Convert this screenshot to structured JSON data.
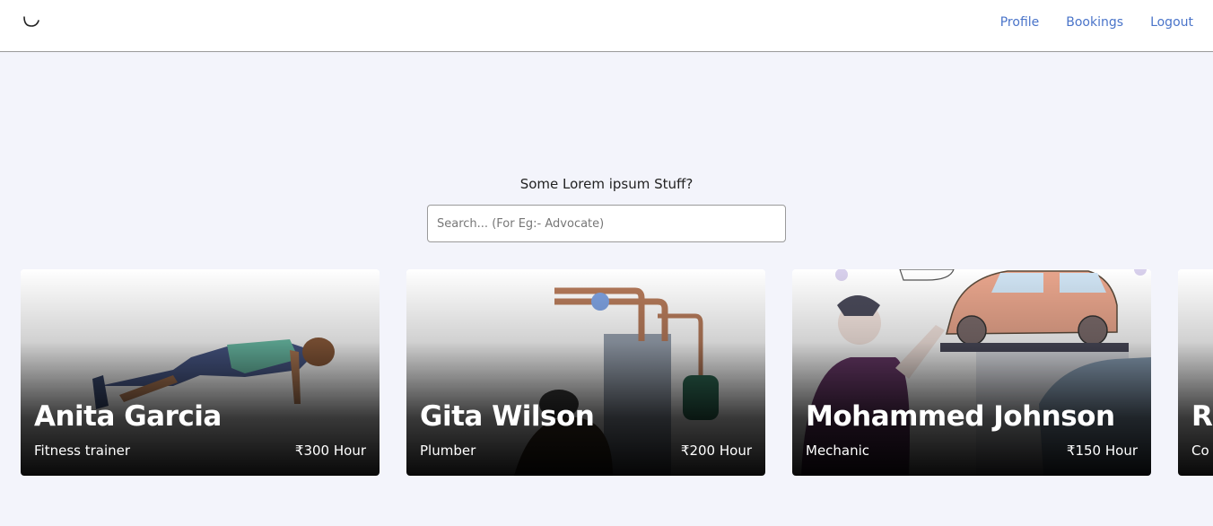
{
  "nav": {
    "links": [
      "Profile",
      "Bookings",
      "Logout"
    ]
  },
  "hero": {
    "title": "Some Lorem ipsum Stuff?",
    "search_placeholder": "Search... (For Eg:- Advocate)"
  },
  "providers": [
    {
      "name": "Anita Garcia",
      "role": "Fitness trainer",
      "rate": "₹300 Hour",
      "illustration": "pushup-person"
    },
    {
      "name": "Gita Wilson",
      "role": "Plumber",
      "rate": "₹200 Hour",
      "illustration": "water-heater-pipes"
    },
    {
      "name": "Mohammed Johnson",
      "role": "Mechanic",
      "rate": "₹150 Hour",
      "illustration": "car-lift"
    },
    {
      "name": "R",
      "role": "Co",
      "rate": "",
      "illustration": "partial-card"
    }
  ],
  "colors": {
    "accent": "#4a74c9",
    "page_bg": "#f3f4fb"
  }
}
